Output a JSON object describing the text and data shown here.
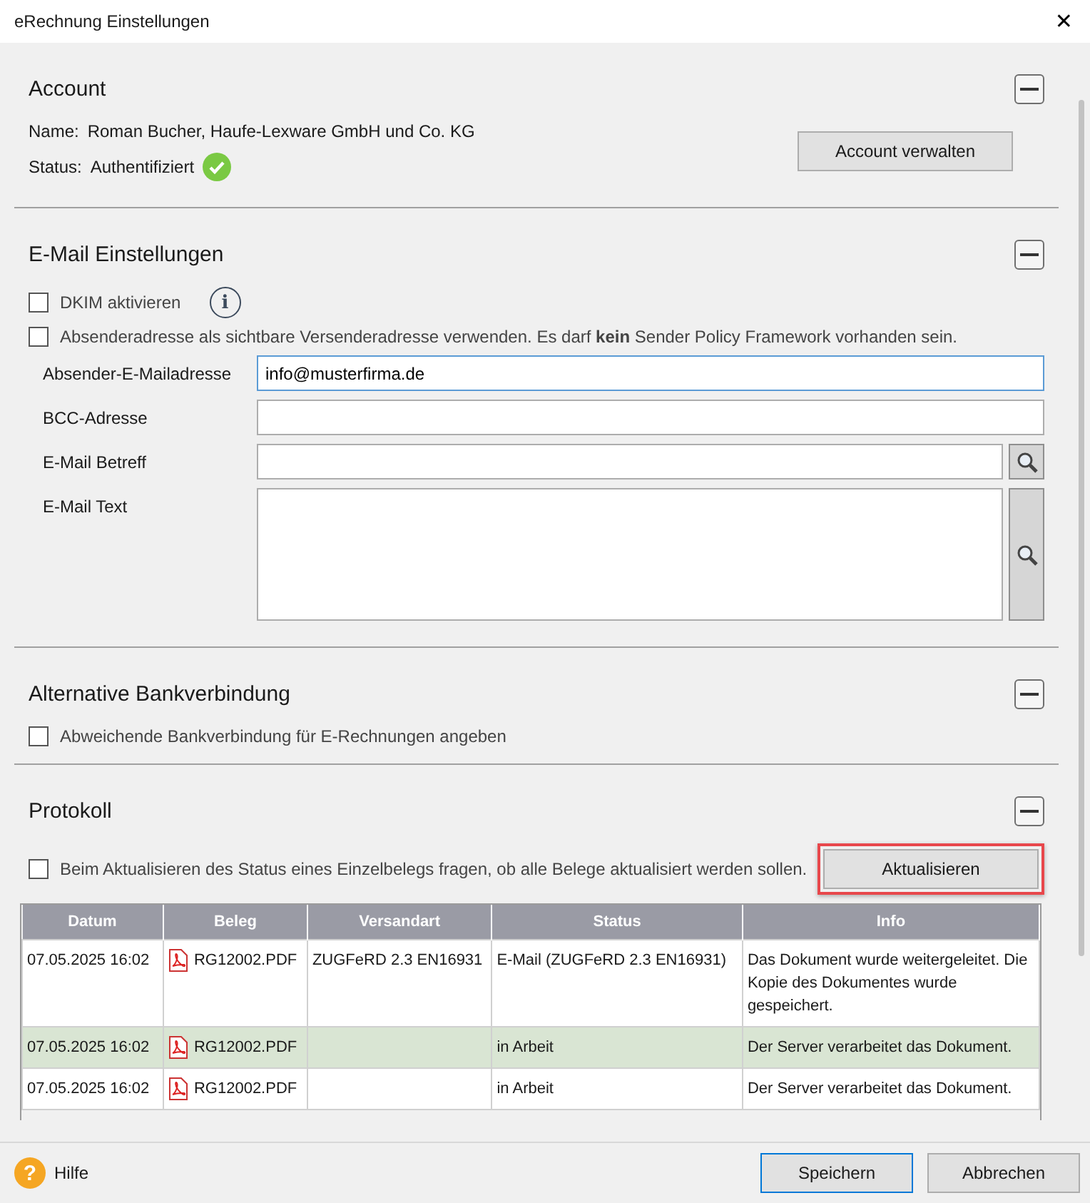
{
  "window": {
    "title": "eRechnung Einstellungen",
    "close": "✕"
  },
  "account": {
    "title": "Account",
    "expanded": true,
    "rows": [
      {
        "label": "Name:",
        "value": "Roman Bucher, Haufe-Lexware GmbH und Co. KG",
        "verified": false
      },
      {
        "label": "Status:",
        "value": "Authentifiziert",
        "verified": true
      }
    ],
    "button": "Account verwalten"
  },
  "email": {
    "title": "E-Mail Einstellungen",
    "expanded": true,
    "checks": [
      {
        "label": "DKIM aktivieren",
        "checked": false,
        "info": "i"
      },
      {
        "label": "Absenderadresse als sichtbare Versenderadresse verwenden. Es darf **kein** Sender Policy Framework vorhanden sein.",
        "checked": false
      }
    ],
    "fields": [
      {
        "label": "Absender-E-Mailadresse",
        "value": "info@musterfirma.de",
        "kind": "line",
        "focused": true,
        "search": false
      },
      {
        "label": "BCC-Adresse",
        "kind": "line",
        "focused": false,
        "search": false
      },
      {
        "label": "E-Mail Betreff",
        "kind": "line",
        "focused": false,
        "search": true
      },
      {
        "label": "E-Mail Text",
        "kind": "area",
        "focused": false,
        "search": true
      }
    ]
  },
  "bank": {
    "title": "Alternative Bankverbindung",
    "expanded": true,
    "checks": [
      {
        "label": "Abweichende Bankverbindung für E-Rechnungen angeben",
        "checked": false
      }
    ]
  },
  "protocol": {
    "title": "Protokoll",
    "expanded": true,
    "check": {
      "label": "Beim Aktualisieren des Status eines Einzelbelegs fragen, ob alle Belege aktualisiert werden sollen.",
      "checked": false
    },
    "button": {
      "label": "Aktualisieren",
      "highlighted": true
    },
    "table": {
      "columns": [
        "Datum",
        "Beleg",
        "Versandart",
        "Status",
        "Info"
      ],
      "rows": [
        {
          "selected": false,
          "cells": [
            "07.05.2025 16:02",
            "RG12002.PDF",
            "ZUGFeRD 2.3 EN16931",
            "E-Mail (ZUGFeRD 2.3 EN16931)",
            "Das Dokument wurde weitergeleitet. Die Kopie des Dokumentes wurde gespeichert."
          ]
        },
        {
          "selected": true,
          "cells": [
            "07.05.2025 16:02",
            "RG12002.PDF",
            "",
            "in Arbeit",
            "Der Server verarbeitet das Dokument."
          ]
        },
        {
          "selected": false,
          "cells": [
            "07.05.2025 16:02",
            "RG12002.PDF",
            "",
            "in Arbeit",
            "Der Server verarbeitet das Dokument."
          ]
        }
      ]
    }
  },
  "footer": {
    "help": "Hilfe",
    "help_icon": "?",
    "buttons": [
      {
        "label": "Speichern",
        "default": true
      },
      {
        "label": "Abbrechen",
        "default": false
      }
    ]
  }
}
